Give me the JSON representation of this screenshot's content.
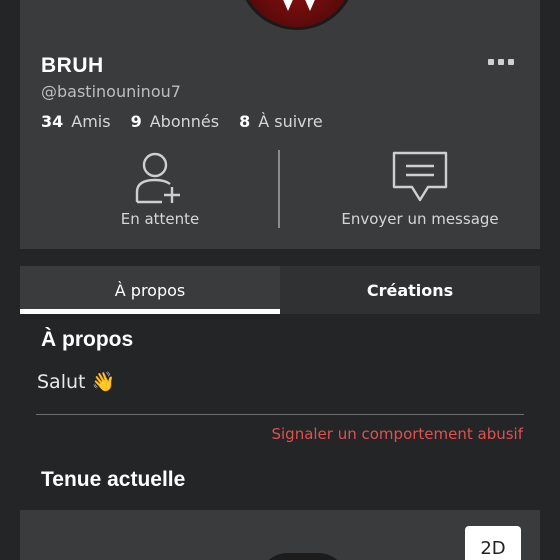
{
  "profile": {
    "display_name": "BRUH",
    "username": "@bastinouninou7",
    "stats": [
      {
        "value": "34",
        "label": "Amis"
      },
      {
        "value": "9",
        "label": "Abonnés"
      },
      {
        "value": "8",
        "label": "À suivre"
      }
    ],
    "actions": {
      "pending_label": "En attente",
      "message_label": "Envoyer un message"
    }
  },
  "tabs": [
    {
      "label": "À propos",
      "active": true
    },
    {
      "label": "Créations",
      "active": false
    }
  ],
  "about": {
    "title": "À propos",
    "text": "Salut 👋",
    "report_label": "Signaler un comportement abusif"
  },
  "outfit": {
    "title": "Tenue actuelle",
    "view_toggle": "2D"
  },
  "colors": {
    "background": "#232527",
    "card": "#393b3d",
    "report": "#e2504f"
  },
  "icons": [
    "more-icon",
    "add-friend-icon",
    "message-icon"
  ]
}
